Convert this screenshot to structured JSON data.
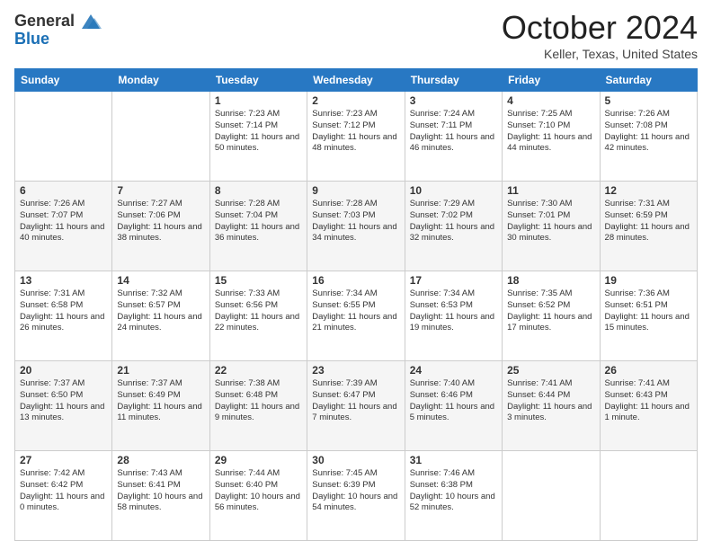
{
  "header": {
    "logo_line1": "General",
    "logo_line2": "Blue",
    "month_title": "October 2024",
    "location": "Keller, Texas, United States"
  },
  "weekdays": [
    "Sunday",
    "Monday",
    "Tuesday",
    "Wednesday",
    "Thursday",
    "Friday",
    "Saturday"
  ],
  "weeks": [
    [
      {
        "day": "",
        "sunrise": "",
        "sunset": "",
        "daylight": ""
      },
      {
        "day": "",
        "sunrise": "",
        "sunset": "",
        "daylight": ""
      },
      {
        "day": "1",
        "sunrise": "Sunrise: 7:23 AM",
        "sunset": "Sunset: 7:14 PM",
        "daylight": "Daylight: 11 hours and 50 minutes."
      },
      {
        "day": "2",
        "sunrise": "Sunrise: 7:23 AM",
        "sunset": "Sunset: 7:12 PM",
        "daylight": "Daylight: 11 hours and 48 minutes."
      },
      {
        "day": "3",
        "sunrise": "Sunrise: 7:24 AM",
        "sunset": "Sunset: 7:11 PM",
        "daylight": "Daylight: 11 hours and 46 minutes."
      },
      {
        "day": "4",
        "sunrise": "Sunrise: 7:25 AM",
        "sunset": "Sunset: 7:10 PM",
        "daylight": "Daylight: 11 hours and 44 minutes."
      },
      {
        "day": "5",
        "sunrise": "Sunrise: 7:26 AM",
        "sunset": "Sunset: 7:08 PM",
        "daylight": "Daylight: 11 hours and 42 minutes."
      }
    ],
    [
      {
        "day": "6",
        "sunrise": "Sunrise: 7:26 AM",
        "sunset": "Sunset: 7:07 PM",
        "daylight": "Daylight: 11 hours and 40 minutes."
      },
      {
        "day": "7",
        "sunrise": "Sunrise: 7:27 AM",
        "sunset": "Sunset: 7:06 PM",
        "daylight": "Daylight: 11 hours and 38 minutes."
      },
      {
        "day": "8",
        "sunrise": "Sunrise: 7:28 AM",
        "sunset": "Sunset: 7:04 PM",
        "daylight": "Daylight: 11 hours and 36 minutes."
      },
      {
        "day": "9",
        "sunrise": "Sunrise: 7:28 AM",
        "sunset": "Sunset: 7:03 PM",
        "daylight": "Daylight: 11 hours and 34 minutes."
      },
      {
        "day": "10",
        "sunrise": "Sunrise: 7:29 AM",
        "sunset": "Sunset: 7:02 PM",
        "daylight": "Daylight: 11 hours and 32 minutes."
      },
      {
        "day": "11",
        "sunrise": "Sunrise: 7:30 AM",
        "sunset": "Sunset: 7:01 PM",
        "daylight": "Daylight: 11 hours and 30 minutes."
      },
      {
        "day": "12",
        "sunrise": "Sunrise: 7:31 AM",
        "sunset": "Sunset: 6:59 PM",
        "daylight": "Daylight: 11 hours and 28 minutes."
      }
    ],
    [
      {
        "day": "13",
        "sunrise": "Sunrise: 7:31 AM",
        "sunset": "Sunset: 6:58 PM",
        "daylight": "Daylight: 11 hours and 26 minutes."
      },
      {
        "day": "14",
        "sunrise": "Sunrise: 7:32 AM",
        "sunset": "Sunset: 6:57 PM",
        "daylight": "Daylight: 11 hours and 24 minutes."
      },
      {
        "day": "15",
        "sunrise": "Sunrise: 7:33 AM",
        "sunset": "Sunset: 6:56 PM",
        "daylight": "Daylight: 11 hours and 22 minutes."
      },
      {
        "day": "16",
        "sunrise": "Sunrise: 7:34 AM",
        "sunset": "Sunset: 6:55 PM",
        "daylight": "Daylight: 11 hours and 21 minutes."
      },
      {
        "day": "17",
        "sunrise": "Sunrise: 7:34 AM",
        "sunset": "Sunset: 6:53 PM",
        "daylight": "Daylight: 11 hours and 19 minutes."
      },
      {
        "day": "18",
        "sunrise": "Sunrise: 7:35 AM",
        "sunset": "Sunset: 6:52 PM",
        "daylight": "Daylight: 11 hours and 17 minutes."
      },
      {
        "day": "19",
        "sunrise": "Sunrise: 7:36 AM",
        "sunset": "Sunset: 6:51 PM",
        "daylight": "Daylight: 11 hours and 15 minutes."
      }
    ],
    [
      {
        "day": "20",
        "sunrise": "Sunrise: 7:37 AM",
        "sunset": "Sunset: 6:50 PM",
        "daylight": "Daylight: 11 hours and 13 minutes."
      },
      {
        "day": "21",
        "sunrise": "Sunrise: 7:37 AM",
        "sunset": "Sunset: 6:49 PM",
        "daylight": "Daylight: 11 hours and 11 minutes."
      },
      {
        "day": "22",
        "sunrise": "Sunrise: 7:38 AM",
        "sunset": "Sunset: 6:48 PM",
        "daylight": "Daylight: 11 hours and 9 minutes."
      },
      {
        "day": "23",
        "sunrise": "Sunrise: 7:39 AM",
        "sunset": "Sunset: 6:47 PM",
        "daylight": "Daylight: 11 hours and 7 minutes."
      },
      {
        "day": "24",
        "sunrise": "Sunrise: 7:40 AM",
        "sunset": "Sunset: 6:46 PM",
        "daylight": "Daylight: 11 hours and 5 minutes."
      },
      {
        "day": "25",
        "sunrise": "Sunrise: 7:41 AM",
        "sunset": "Sunset: 6:44 PM",
        "daylight": "Daylight: 11 hours and 3 minutes."
      },
      {
        "day": "26",
        "sunrise": "Sunrise: 7:41 AM",
        "sunset": "Sunset: 6:43 PM",
        "daylight": "Daylight: 11 hours and 1 minute."
      }
    ],
    [
      {
        "day": "27",
        "sunrise": "Sunrise: 7:42 AM",
        "sunset": "Sunset: 6:42 PM",
        "daylight": "Daylight: 11 hours and 0 minutes."
      },
      {
        "day": "28",
        "sunrise": "Sunrise: 7:43 AM",
        "sunset": "Sunset: 6:41 PM",
        "daylight": "Daylight: 10 hours and 58 minutes."
      },
      {
        "day": "29",
        "sunrise": "Sunrise: 7:44 AM",
        "sunset": "Sunset: 6:40 PM",
        "daylight": "Daylight: 10 hours and 56 minutes."
      },
      {
        "day": "30",
        "sunrise": "Sunrise: 7:45 AM",
        "sunset": "Sunset: 6:39 PM",
        "daylight": "Daylight: 10 hours and 54 minutes."
      },
      {
        "day": "31",
        "sunrise": "Sunrise: 7:46 AM",
        "sunset": "Sunset: 6:38 PM",
        "daylight": "Daylight: 10 hours and 52 minutes."
      },
      {
        "day": "",
        "sunrise": "",
        "sunset": "",
        "daylight": ""
      },
      {
        "day": "",
        "sunrise": "",
        "sunset": "",
        "daylight": ""
      }
    ]
  ]
}
